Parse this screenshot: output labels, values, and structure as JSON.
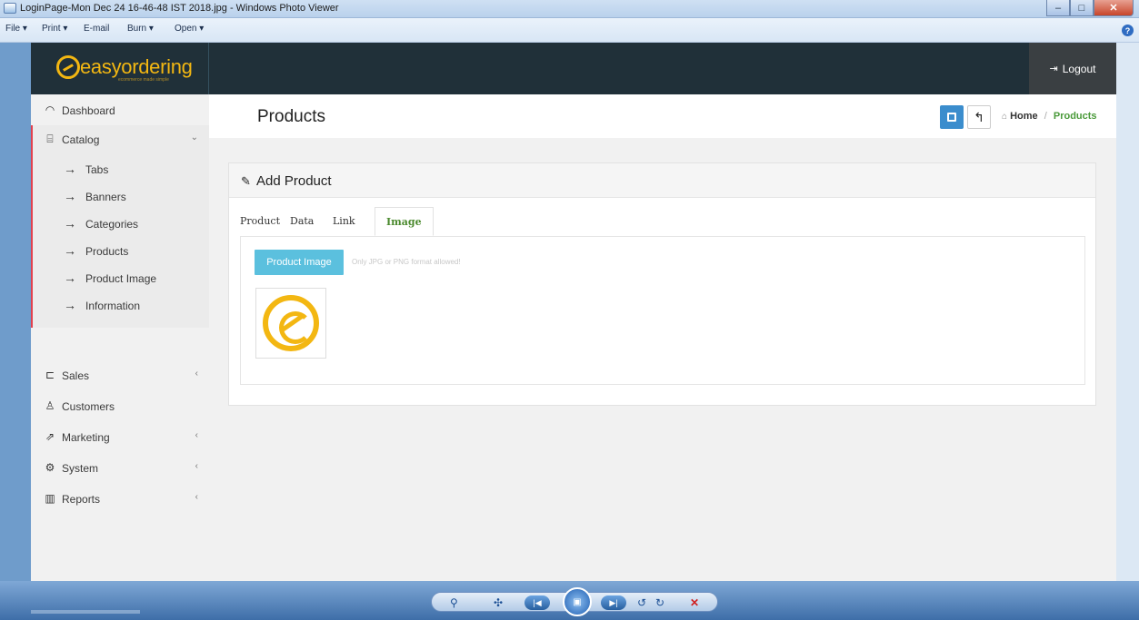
{
  "window": {
    "title": "LoginPage-Mon Dec 24 16-46-48 IST 2018.jpg - Windows Photo Viewer",
    "menu": [
      "File ▾",
      "Print ▾",
      "E-mail",
      "Burn ▾",
      "Open ▾"
    ]
  },
  "app": {
    "logo_text": "easyordering",
    "logo_tagline": "ecommerce made simple",
    "logout_label": "Logout"
  },
  "sidebar": {
    "items": [
      {
        "label": "Dashboard",
        "icon": "dashboard-icon"
      },
      {
        "label": "Catalog",
        "icon": "catalog-icon"
      },
      {
        "label": "Sales",
        "icon": "cart-icon"
      },
      {
        "label": "Customers",
        "icon": "user-icon"
      },
      {
        "label": "Marketing",
        "icon": "share-icon"
      },
      {
        "label": "System",
        "icon": "gear-icon"
      },
      {
        "label": "Reports",
        "icon": "bar-chart-icon"
      }
    ],
    "catalog_children": [
      "Tabs",
      "Banners",
      "Categories",
      "Products",
      "Product Image",
      "Information"
    ]
  },
  "page": {
    "title": "Products",
    "breadcrumb": {
      "home": "Home",
      "separator": "/",
      "current": "Products"
    }
  },
  "panel": {
    "title": "Add Product",
    "tabs": [
      "Product",
      "Data",
      "Link",
      "Image"
    ],
    "active_tab": "Image",
    "image_button_label": "Product Image",
    "hint": "Only JPG or PNG format allowed!"
  },
  "colors": {
    "accent_yellow": "#f3b712",
    "topbar": "#203039",
    "active_tab_green": "#4b8a2e",
    "primary_blue": "#3b8dcd",
    "info_blue": "#5bc0de",
    "sidebar_marker": "#e2414e"
  }
}
